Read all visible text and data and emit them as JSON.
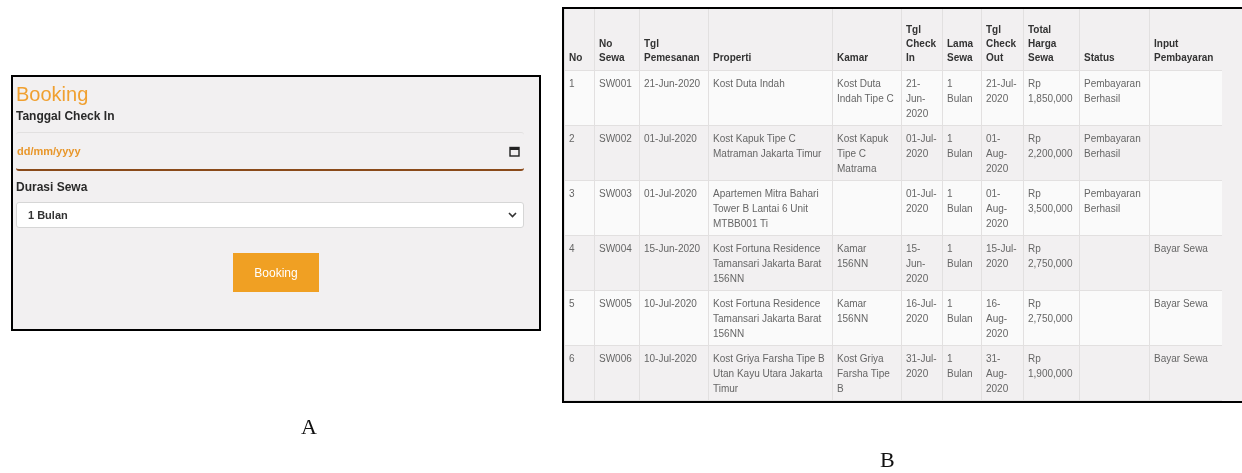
{
  "figure_a": {
    "caption": "A",
    "form": {
      "title": "Booking",
      "fields": [
        {
          "kind": "date",
          "label": "Tanggal Check In",
          "placeholder": "dd/mm/yyyy"
        },
        {
          "kind": "select",
          "label": "Durasi Sewa",
          "value": "1 Bulan"
        }
      ],
      "button": "Booking"
    }
  },
  "figure_b": {
    "caption": "B",
    "table": {
      "columns": [
        "No",
        "No Sewa",
        "Tgl Pemesanan",
        "Properti",
        "Kamar",
        "Tgl Check In",
        "Lama Sewa",
        "Tgl Check Out",
        "Total Harga Sewa",
        "Status",
        "Input Pembayaran"
      ],
      "rows": [
        [
          "1",
          "SW001",
          "21-Jun-2020",
          "Kost Duta Indah",
          "Kost Duta Indah Tipe C",
          "21-Jun-2020",
          "1 Bulan",
          "21-Jul-2020",
          "Rp 1,850,000",
          "Pembayaran Berhasil",
          null
        ],
        [
          "2",
          "SW002",
          "01-Jul-2020",
          "Kost Kapuk Tipe C Matraman Jakarta Timur",
          "Kost Kapuk Tipe C Matrama",
          "01-Jul-2020",
          "1 Bulan",
          "01-Aug-2020",
          "Rp 2,200,000",
          "Pembayaran Berhasil",
          null
        ],
        [
          "3",
          "SW003",
          "01-Jul-2020",
          "Apartemen Mitra Bahari Tower B Lantai 6 Unit MTBB001 Ti",
          null,
          "01-Jul-2020",
          "1 Bulan",
          "01-Aug-2020",
          "Rp 3,500,000",
          "Pembayaran Berhasil",
          null
        ],
        [
          "4",
          "SW004",
          "15-Jun-2020",
          "Kost Fortuna Residence Tamansari Jakarta Barat 156NN",
          "Kamar 156NN",
          "15-Jun-2020",
          "1 Bulan",
          "15-Jul-2020",
          "Rp 2,750,000",
          null,
          "Bayar Sewa"
        ],
        [
          "5",
          "SW005",
          "10-Jul-2020",
          "Kost Fortuna Residence Tamansari Jakarta Barat 156NN",
          "Kamar 156NN",
          "16-Jul-2020",
          "1 Bulan",
          "16-Aug-2020",
          "Rp 2,750,000",
          null,
          "Bayar Sewa"
        ],
        [
          "6",
          "SW006",
          "10-Jul-2020",
          "Kost Griya Farsha Tipe B Utan Kayu Utara Jakarta Timur",
          "Kost Griya Farsha Tipe B",
          "31-Jul-2020",
          "1 Bulan",
          "31-Aug-2020",
          "Rp 1,900,000",
          null,
          "Bayar Sewa"
        ]
      ]
    }
  }
}
